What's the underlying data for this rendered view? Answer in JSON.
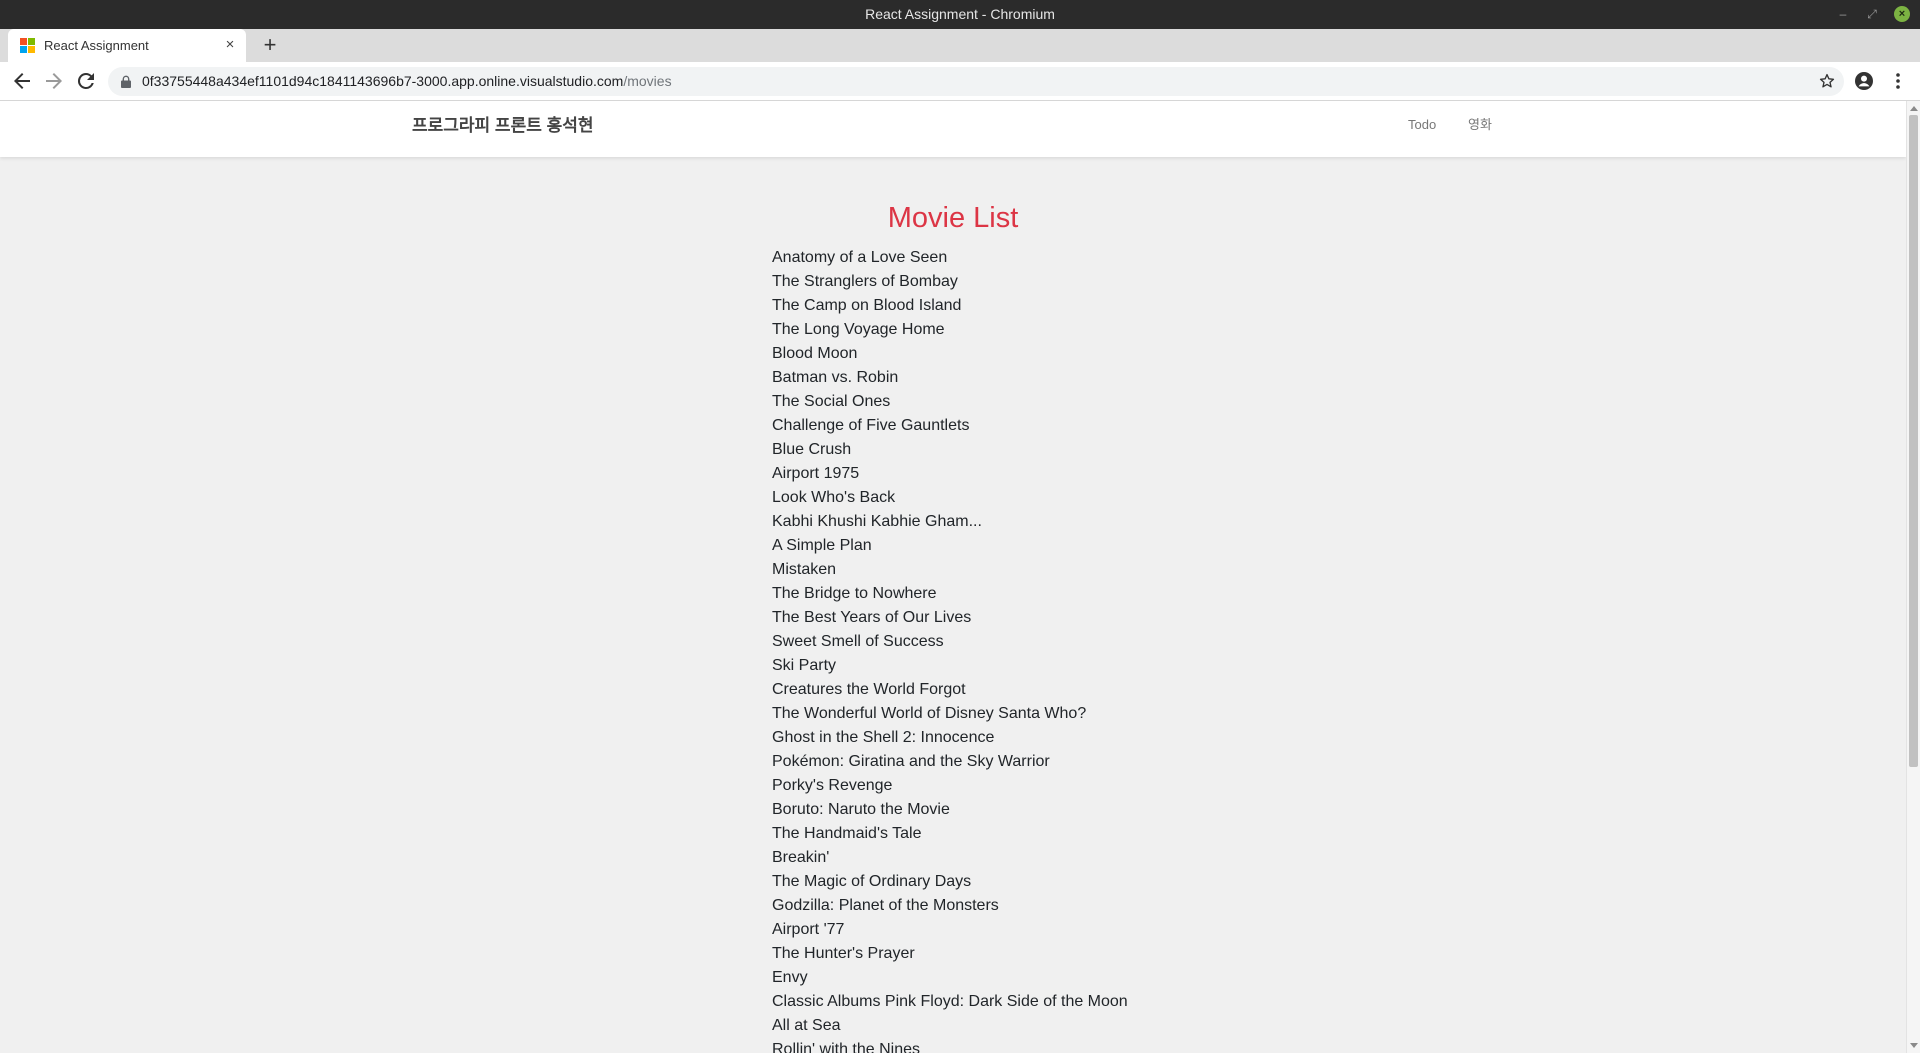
{
  "window": {
    "title": "React Assignment - Chromium"
  },
  "browser": {
    "tab_title": "React Assignment",
    "url_host": "0f33755448a434ef1101d94c1841143696b7-3000.app.online.visualstudio.com",
    "url_path": "/movies"
  },
  "app": {
    "brand": "프로그라피 프론트 홍석현",
    "nav": {
      "todo": "Todo",
      "movie": "영화"
    },
    "heading": "Movie List",
    "heading_color": "#dc3545"
  },
  "movies": [
    "Anatomy of a Love Seen",
    "The Stranglers of Bombay",
    "The Camp on Blood Island",
    "The Long Voyage Home",
    "Blood Moon",
    "Batman vs. Robin",
    "The Social Ones",
    "Challenge of Five Gauntlets",
    "Blue Crush",
    "Airport 1975",
    "Look Who's Back",
    "Kabhi Khushi Kabhie Gham...",
    "A Simple Plan",
    "Mistaken",
    "The Bridge to Nowhere",
    "The Best Years of Our Lives",
    "Sweet Smell of Success",
    "Ski Party",
    "Creatures the World Forgot",
    "The Wonderful World of Disney Santa Who?",
    "Ghost in the Shell 2: Innocence",
    "Pokémon: Giratina and the Sky Warrior",
    "Porky's Revenge",
    "Boruto: Naruto the Movie",
    "The Handmaid's Tale",
    "Breakin'",
    "The Magic of Ordinary Days",
    "Godzilla: Planet of the Monsters",
    "Airport '77",
    "The Hunter's Prayer",
    "Envy",
    "Classic Albums Pink Floyd: Dark Side of the Moon",
    "All at Sea",
    "Rollin' with the Nines"
  ]
}
